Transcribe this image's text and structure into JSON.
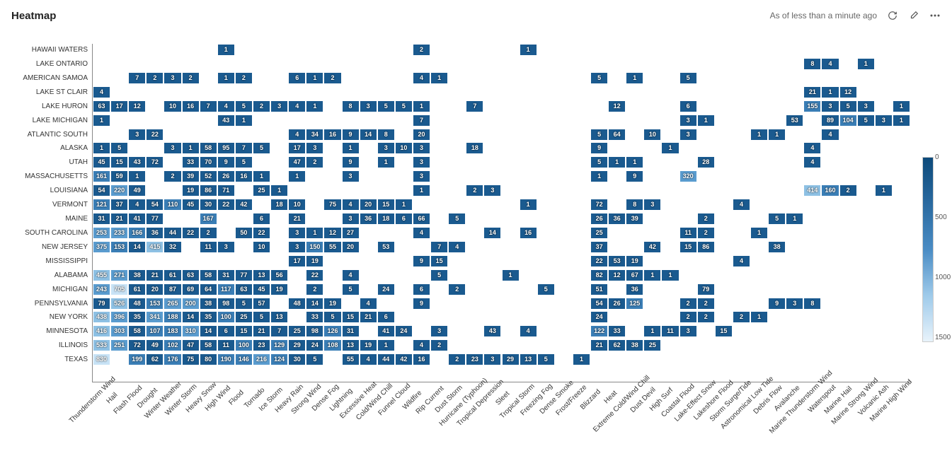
{
  "header": {
    "title": "Heatmap",
    "timestamp": "As of less than a minute ago"
  },
  "chart_data": {
    "type": "heatmap",
    "xlabel": "",
    "ylabel": "",
    "x_categories": [
      "Thunderstorm Wind",
      "Hail",
      "Flash Flood",
      "Drought",
      "Winter Weather",
      "Winter Storm",
      "Heavy Snow",
      "High Wind",
      "Flood",
      "Tornado",
      "Ice Storm",
      "Heavy Rain",
      "Strong Wind",
      "Dense Fog",
      "Lightning",
      "Excessive Heat",
      "Cold/Wind Chill",
      "Funnel Cloud",
      "Wildfire",
      "Rip Current",
      "Dust Storm",
      "Hurricane (Typhoon)",
      "Tropical Depression",
      "Sleet",
      "Tropical Storm",
      "Freezing Fog",
      "Dense Smoke",
      "Frost/Freeze",
      "Blizzard",
      "Heat",
      "Extreme Cold/Wind Chill",
      "Dust Devil",
      "High Surf",
      "Coastal Flood",
      "Lake-Effect Snow",
      "Lakeshore Flood",
      "Storm Surge/Tide",
      "Astronomical Low Tide",
      "Debris Flow",
      "Avalanche",
      "Marine Thunderstorm Wind",
      "Waterspout",
      "Marine Hail",
      "Marine Strong Wind",
      "Volcanic Ash",
      "Marine High Wind"
    ],
    "y_categories": [
      "HAWAII WATERS",
      "LAKE ONTARIO",
      "AMERICAN SAMOA",
      "LAKE ST CLAIR",
      "LAKE HURON",
      "LAKE MICHIGAN",
      "ATLANTIC SOUTH",
      "ALASKA",
      "UTAH",
      "MASSACHUSETTS",
      "LOUISIANA",
      "VERMONT",
      "MAINE",
      "SOUTH CAROLINA",
      "NEW JERSEY",
      "MISSISSIPPI",
      "ALABAMA",
      "MICHIGAN",
      "PENNSYLVANIA",
      "NEW YORK",
      "MINNESOTA",
      "ILLINOIS",
      "TEXAS"
    ],
    "legend_ticks": [
      0,
      500,
      1000,
      1500
    ],
    "series": [
      {
        "name": "HAWAII WATERS",
        "cells": {
          "7": 1,
          "18": 2,
          "24": 1
        }
      },
      {
        "name": "LAKE ONTARIO",
        "cells": {
          "40": 8,
          "41": 4,
          "43": 1
        }
      },
      {
        "name": "AMERICAN SAMOA",
        "cells": {
          "2": 7,
          "3": 2,
          "4": 3,
          "5": 2,
          "7": 1,
          "8": 2,
          "11": 6,
          "12": 1,
          "13": 2,
          "18": 4,
          "19": 1,
          "28": 5,
          "30": 1,
          "33": 5
        }
      },
      {
        "name": "LAKE ST CLAIR",
        "cells": {
          "0": 4,
          "40": 21,
          "41": 1,
          "42": 12
        }
      },
      {
        "name": "LAKE HURON",
        "cells": {
          "0": 63,
          "1": 17,
          "2": 12,
          "4": 10,
          "5": 16,
          "6": 7,
          "7": 4,
          "8": 5,
          "9": 2,
          "10": 3,
          "11": 4,
          "12": 1,
          "14": 8,
          "15": 3,
          "16": 5,
          "17": 5,
          "18": 1,
          "21": 7,
          "29": 12,
          "33": 6,
          "40": 155,
          "41": 3,
          "42": 5,
          "43": 3,
          "45": 1
        }
      },
      {
        "name": "LAKE MICHIGAN",
        "cells": {
          "0": 1,
          "7": 43,
          "8": 1,
          "18": 7,
          "33": 3,
          "34": 1,
          "39": 53,
          "41": 89,
          "42": 104,
          "43": 5,
          "44": 3,
          "45": 1
        }
      },
      {
        "name": "ATLANTIC SOUTH",
        "cells": {
          "2": 3,
          "3": 22,
          "11": 4,
          "12": 34,
          "13": 16,
          "14": 9,
          "15": 14,
          "16": 8,
          "18": 20,
          "28": 5,
          "29": 64,
          "31": 10,
          "33": 3,
          "37": 1,
          "38": 1,
          "41": 4
        }
      },
      {
        "name": "ALASKA",
        "cells": {
          "0": 1,
          "1": 5,
          "4": 3,
          "5": 1,
          "6": 58,
          "7": 95,
          "8": 7,
          "9": 5,
          "11": 17,
          "12": 3,
          "14": 1,
          "16": 3,
          "17": 10,
          "18": 3,
          "21": 18,
          "28": 9,
          "32": 1,
          "40": 4
        }
      },
      {
        "name": "UTAH",
        "cells": {
          "0": 45,
          "1": 15,
          "2": 43,
          "3": 72,
          "5": 33,
          "6": 70,
          "7": 9,
          "8": 5,
          "11": 47,
          "12": 2,
          "14": 9,
          "16": 1,
          "18": 3,
          "28": 5,
          "29": 1,
          "30": 1,
          "34": 28,
          "40": 4
        }
      },
      {
        "name": "MASSACHUSETTS",
        "cells": {
          "0": 161,
          "1": 59,
          "2": 1,
          "4": 2,
          "5": 39,
          "6": 52,
          "7": 26,
          "8": 16,
          "9": 1,
          "11": 1,
          "14": 3,
          "18": 3,
          "28": 1,
          "30": 9,
          "33": 320
        }
      },
      {
        "name": "LOUISIANA",
        "cells": {
          "0": 54,
          "1": 220,
          "2": 49,
          "5": 19,
          "6": 86,
          "7": 71,
          "9": 25,
          "10": 1,
          "18": 1,
          "21": 2,
          "22": 3,
          "40": 414,
          "41": 160,
          "42": 2,
          "44": 1
        }
      },
      {
        "name": "VERMONT",
        "cells": {
          "0": 121,
          "1": 37,
          "2": 4,
          "3": 54,
          "4": 110,
          "5": 45,
          "6": 30,
          "7": 22,
          "8": 42,
          "10": 18,
          "11": 10,
          "13": 75,
          "14": 4,
          "15": 20,
          "16": 15,
          "17": 1,
          "24": 1,
          "28": 72,
          "30": 8,
          "31": 3,
          "36": 4
        }
      },
      {
        "name": "MAINE",
        "cells": {
          "0": 31,
          "1": 21,
          "2": 41,
          "3": 77,
          "6": 167,
          "9": 6,
          "11": 21,
          "14": 3,
          "15": 36,
          "16": 18,
          "17": 6,
          "18": 66,
          "20": 5,
          "28": 26,
          "29": 36,
          "30": 39,
          "34": 2,
          "38": 5,
          "39": 1
        }
      },
      {
        "name": "SOUTH CAROLINA",
        "cells": {
          "0": 253,
          "1": 233,
          "2": 166,
          "3": 36,
          "4": 44,
          "5": 22,
          "6": 2,
          "8": 50,
          "9": 22,
          "11": 3,
          "12": 1,
          "13": 12,
          "14": 27,
          "18": 4,
          "22": 14,
          "24": 16,
          "28": 25,
          "33": 11,
          "34": 2,
          "37": 1
        }
      },
      {
        "name": "NEW JERSEY",
        "cells": {
          "0": 375,
          "1": 153,
          "2": 14,
          "3": 415,
          "4": 32,
          "6": 11,
          "7": 3,
          "9": 10,
          "11": 3,
          "12": 150,
          "13": 55,
          "14": 20,
          "16": 53,
          "19": 7,
          "20": 4,
          "28": 37,
          "31": 42,
          "33": 15,
          "34": 86,
          "38": 38
        }
      },
      {
        "name": "MISSISSIPPI",
        "cells": {
          "11": 17,
          "12": 19,
          "18": 9,
          "19": 15,
          "28": 22,
          "29": 53,
          "30": 19,
          "36": 4
        }
      },
      {
        "name": "ALABAMA",
        "cells": {
          "0": 455,
          "1": 271,
          "2": 38,
          "3": 21,
          "4": 61,
          "5": 63,
          "6": 58,
          "7": 31,
          "8": 77,
          "9": 13,
          "10": 56,
          "12": 22,
          "14": 4,
          "19": 5,
          "23": 1,
          "28": 82,
          "29": 12,
          "30": 67,
          "31": 1,
          "32": 1
        }
      },
      {
        "name": "MICHIGAN",
        "cells": {
          "0": 243,
          "1": 705,
          "2": 61,
          "3": 20,
          "4": 87,
          "5": 69,
          "6": 64,
          "7": 117,
          "8": 63,
          "9": 45,
          "10": 19,
          "12": 2,
          "14": 5,
          "16": 24,
          "18": 6,
          "20": 2,
          "25": 5,
          "28": 51,
          "30": 36,
          "34": 79
        }
      },
      {
        "name": "PENNSYLVANIA",
        "cells": {
          "0": 79,
          "1": 526,
          "2": 48,
          "3": 153,
          "4": 265,
          "5": 200,
          "6": 38,
          "7": 98,
          "8": 5,
          "9": 57,
          "11": 48,
          "12": 14,
          "13": 19,
          "15": 4,
          "18": 9,
          "28": 54,
          "29": 26,
          "30": 125,
          "33": 2,
          "34": 2,
          "38": 9,
          "39": 3,
          "40": 8
        }
      },
      {
        "name": "NEW YORK",
        "cells": {
          "0": 438,
          "1": 396,
          "2": 35,
          "3": 341,
          "4": 188,
          "5": 14,
          "6": 35,
          "7": 100,
          "8": 25,
          "9": 5,
          "10": 13,
          "12": 33,
          "13": 5,
          "14": 15,
          "15": 21,
          "16": 6,
          "28": 24,
          "33": 2,
          "34": 2,
          "36": 2,
          "37": 1
        }
      },
      {
        "name": "MINNESOTA",
        "cells": {
          "0": 416,
          "1": 303,
          "2": 58,
          "3": 107,
          "4": 183,
          "5": 310,
          "6": 14,
          "7": 6,
          "8": 15,
          "9": 21,
          "10": 7,
          "11": 25,
          "12": 98,
          "13": 126,
          "14": 31,
          "16": 41,
          "17": 24,
          "19": 3,
          "22": 43,
          "24": 4,
          "28": 122,
          "29": 33,
          "31": 1,
          "32": 11,
          "33": 3,
          "35": 15
        }
      },
      {
        "name": "ILLINOIS",
        "cells": {
          "0": 533,
          "1": 251,
          "2": 72,
          "3": 49,
          "4": 102,
          "5": 47,
          "6": 58,
          "7": 11,
          "8": 100,
          "9": 23,
          "10": 129,
          "11": 29,
          "12": 24,
          "13": 108,
          "14": 13,
          "15": 19,
          "16": 1,
          "18": 4,
          "19": 2,
          "28": 21,
          "29": 62,
          "30": 38,
          "31": 25
        }
      },
      {
        "name": "TEXAS",
        "cells": {
          "0": 830,
          "2": 199,
          "3": 62,
          "4": 176,
          "5": 75,
          "6": 80,
          "7": 190,
          "8": 146,
          "9": 216,
          "10": 124,
          "11": 30,
          "12": 5,
          "14": 55,
          "15": 4,
          "16": 44,
          "17": 42,
          "18": 16,
          "20": 2,
          "21": 23,
          "22": 3,
          "23": 29,
          "24": 13,
          "25": 5,
          "27": 1
        }
      }
    ]
  }
}
